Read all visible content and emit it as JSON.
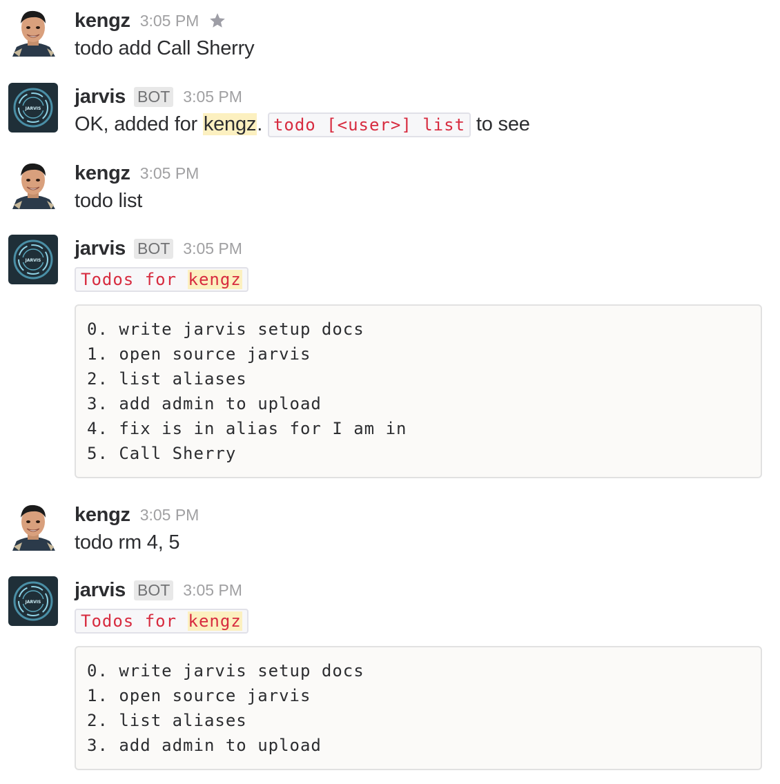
{
  "users": {
    "human": {
      "name": "kengz"
    },
    "bot": {
      "name": "jarvis",
      "badge": "BOT",
      "avatar_label": "JARVIS"
    }
  },
  "messages": [
    {
      "sender": "kengz",
      "time": "3:05 PM",
      "starred": true,
      "text": "todo add Call Sherry"
    },
    {
      "sender": "jarvis",
      "badge": "BOT",
      "time": "3:05 PM",
      "text_prefix": "OK, added for ",
      "mention": "kengz",
      "text_mid": ".",
      "inline_code": "todo [<user>] list",
      "text_suffix": "to see"
    },
    {
      "sender": "kengz",
      "time": "3:05 PM",
      "text": "todo list"
    },
    {
      "sender": "jarvis",
      "badge": "BOT",
      "time": "3:05 PM",
      "code_prefix": "Todos for ",
      "code_mention": "kengz",
      "code_block": [
        "0. write jarvis setup docs",
        "1. open source jarvis",
        "2. list aliases",
        "3. add admin to upload",
        "4. fix is in alias for I am in",
        "5. Call Sherry"
      ]
    },
    {
      "sender": "kengz",
      "time": "3:05 PM",
      "text": "todo rm 4, 5"
    },
    {
      "sender": "jarvis",
      "badge": "BOT",
      "time": "3:05 PM",
      "code_prefix": "Todos for ",
      "code_mention": "kengz",
      "code_block": [
        "0. write jarvis setup docs",
        "1. open source jarvis",
        "2. list aliases",
        "3. add admin to upload"
      ]
    }
  ],
  "colors": {
    "mention_bg": "#fcf0c0",
    "code_text": "#d72b3f",
    "timestamp": "#a0a0a2"
  },
  "icons": [
    "star-icon",
    "user-avatar",
    "bot-avatar"
  ]
}
